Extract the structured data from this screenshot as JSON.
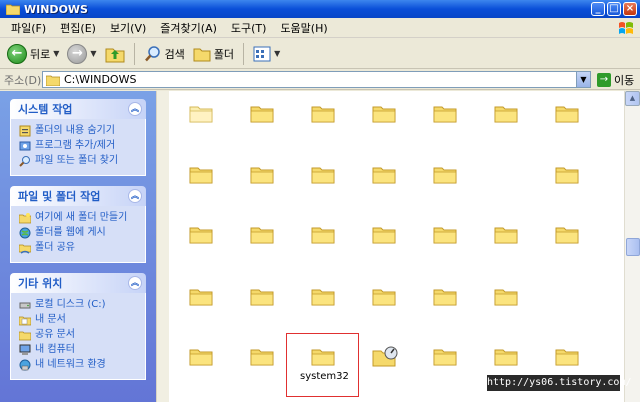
{
  "window": {
    "title": "WINDOWS"
  },
  "menu": [
    "파일(F)",
    "편집(E)",
    "보기(V)",
    "즐겨찾기(A)",
    "도구(T)",
    "도움말(H)"
  ],
  "toolbar": {
    "back_label": "뒤로",
    "search_label": "검색",
    "folders_label": "폴더"
  },
  "address": {
    "label": "주소(D)",
    "value": "C:\\WINDOWS",
    "go_label": "이동"
  },
  "panels": [
    {
      "title": "시스템 작업",
      "tasks": [
        "폴더의 내용 숨기기",
        "프로그램 추가/제거",
        "파일 또는 폴더 찾기"
      ]
    },
    {
      "title": "파일 및 폴더 작업",
      "tasks": [
        "여기에 새 폴더 만들기",
        "폴더를 웹에 게시",
        "폴더 공유"
      ]
    },
    {
      "title": "기타 위치",
      "tasks": [
        "로컬 디스크 (C:)",
        "내 문서",
        "공유 문서",
        "내 컴퓨터",
        "내 네트워크 환경"
      ]
    }
  ],
  "selected_folder": {
    "label": "system32"
  },
  "watermark": "http://ys06.tistory.com/",
  "colors": {
    "title_bar": "#0a4fd8",
    "task_pane": "#6375d6",
    "link": "#215dc6",
    "selection_border": "#e03030"
  }
}
